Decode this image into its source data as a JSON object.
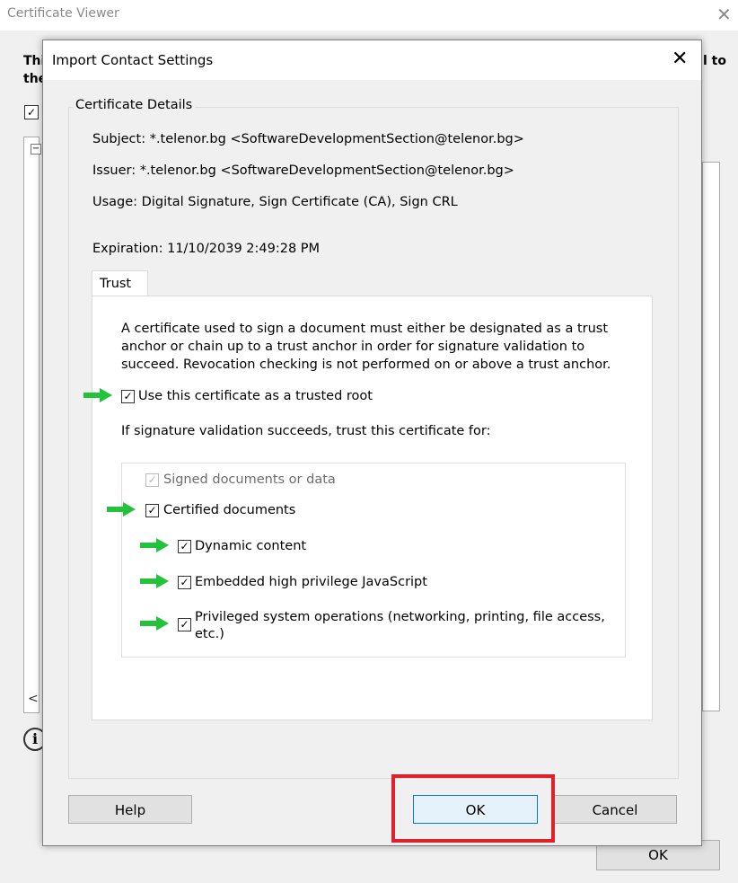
{
  "background_window": {
    "title": "Certificate Viewer",
    "close_glyph": "✕",
    "text_left_1": "Thi",
    "text_left_2": "the",
    "text_right": "l to",
    "collapse_glyph": "−",
    "scroll_left_glyph": "<",
    "info_glyph": "i",
    "ok_label": "OK"
  },
  "dialog": {
    "title": "Import Contact Settings",
    "close_glyph": "✕",
    "group_title": "Certificate Details",
    "subject": "Subject:    *.telenor.bg <SoftwareDevelopmentSection@telenor.bg>",
    "issuer": "Issuer:    *.telenor.bg <SoftwareDevelopmentSection@telenor.bg>",
    "usage": "Usage:    Digital Signature, Sign Certificate (CA), Sign CRL",
    "expiration": "Expiration:    11/10/2039 2:49:28 PM",
    "tab_trust": "Trust",
    "trust_paragraph": "A certificate used to sign a document must either be designated as a trust anchor or chain up to a trust anchor in order for signature validation to succeed.  Revocation checking is not performed on or above a trust anchor.",
    "trusted_root_label": "Use this certificate as a trusted root",
    "trust_for_text": "If signature validation succeeds, trust this certificate for:",
    "options": {
      "signed_documents": "Signed documents or data",
      "certified_documents": "Certified documents",
      "dynamic_content": "Dynamic content",
      "embedded_js": "Embedded high privilege JavaScript",
      "privileged_ops_1": "Privileged system operations (networking, printing, file access,",
      "privileged_ops_2": "etc.)"
    },
    "check_glyph": "✓",
    "buttons": {
      "help": "Help",
      "ok": "OK",
      "cancel": "Cancel"
    }
  },
  "colors": {
    "annotation_arrow": "#22c23a",
    "highlight_box": "#e0212b",
    "primary_button_border": "#0078d7"
  }
}
